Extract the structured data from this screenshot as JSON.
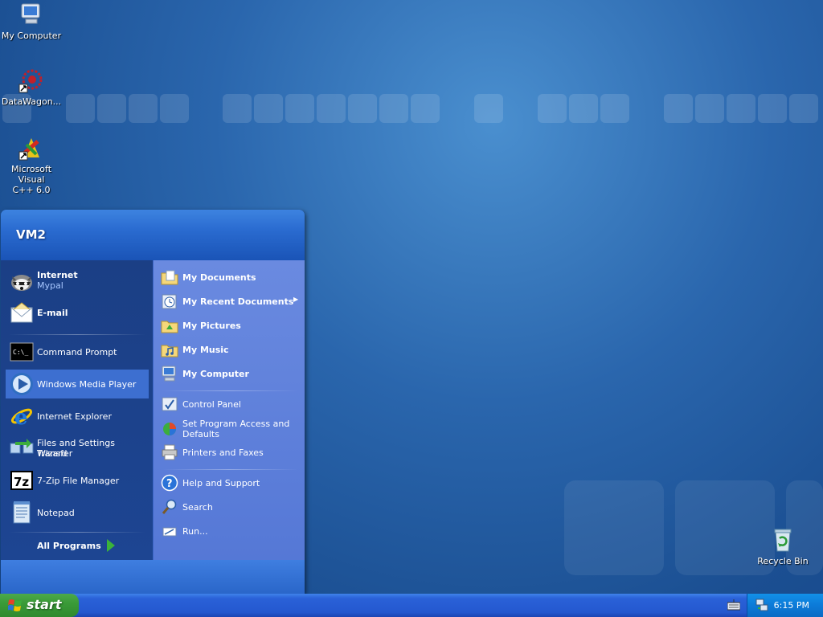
{
  "desktop": {
    "icons": [
      {
        "label": "My Computer",
        "icon": "my-computer-icon"
      },
      {
        "label": "DataWagon...",
        "icon": "datawagon-icon"
      },
      {
        "label_line1": "Microsoft Visual",
        "label_line2": "C++ 6.0",
        "icon": "visual-cpp-icon"
      },
      {
        "label": "Recycle Bin",
        "icon": "recycle-bin-icon"
      }
    ]
  },
  "start_menu": {
    "user_name": "VM2",
    "pinned": [
      {
        "label": "Internet",
        "sub": "Mypal",
        "icon": "mypal-raccoon-icon"
      },
      {
        "label": "E-mail",
        "icon": "email-icon"
      }
    ],
    "recent": [
      {
        "label": "Command Prompt",
        "icon": "command-prompt-icon"
      },
      {
        "label": "Windows Media Player",
        "icon": "media-player-icon",
        "selected": true
      },
      {
        "label": "Internet Explorer",
        "icon": "internet-explorer-icon"
      },
      {
        "label_line1": "Files and Settings Transfer",
        "label_line2": "Wizard",
        "icon": "transfer-wizard-icon"
      },
      {
        "label": "7-Zip File Manager",
        "icon": "7zip-icon"
      },
      {
        "label": "Notepad",
        "icon": "notepad-icon"
      }
    ],
    "all_programs": "All Programs",
    "places": [
      {
        "label": "My Documents",
        "icon": "folder-documents-icon"
      },
      {
        "label": "My Recent Documents",
        "icon": "recent-documents-icon",
        "arrow": "▶"
      },
      {
        "label": "My Pictures",
        "icon": "folder-pictures-icon"
      },
      {
        "label": "My Music",
        "icon": "folder-music-icon"
      },
      {
        "label": "My Computer",
        "icon": "my-computer-icon"
      }
    ],
    "settings": [
      {
        "label": "Control Panel",
        "icon": "control-panel-icon"
      },
      {
        "label_line1": "Set Program Access and",
        "label_line2": "Defaults",
        "icon": "program-access-icon"
      },
      {
        "label": "Printers and Faxes",
        "icon": "printer-icon"
      }
    ],
    "help": [
      {
        "label": "Help and Support",
        "icon": "help-icon"
      },
      {
        "label": "Search",
        "icon": "search-icon"
      },
      {
        "label": "Run...",
        "icon": "run-icon"
      }
    ]
  },
  "taskbar": {
    "start_label": "start",
    "clock": "6:15 PM"
  },
  "colors": {
    "desktop_blue": "#2a66ad",
    "taskbar_blue": "#2458cf",
    "start_green": "#3a9b38",
    "menu_accent_orange": "#e98d2c"
  }
}
